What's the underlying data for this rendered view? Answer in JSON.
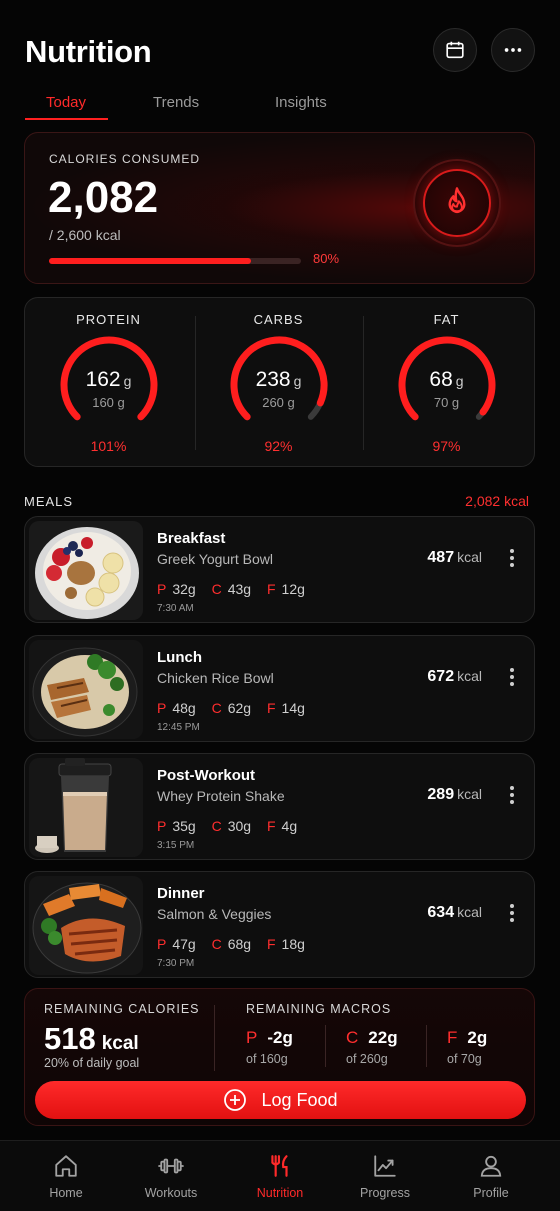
{
  "header": {
    "title": "Nutrition",
    "calendar_icon": "calendar-icon",
    "more_icon": "more-horizontal-icon"
  },
  "tabs": [
    {
      "label": "Today",
      "active": true
    },
    {
      "label": "Trends"
    },
    {
      "label": "Insights"
    }
  ],
  "calories": {
    "label": "CALORIES CONSUMED",
    "value": "2,082",
    "goal": "/ 2,600 kcal",
    "percent_label": "80%",
    "progress": 0.8,
    "icon": "flame-icon"
  },
  "macros": [
    {
      "name": "PROTEIN",
      "value": "162",
      "unit": "g",
      "goal": "160 g",
      "percent_label": "101%",
      "fraction": 1.0
    },
    {
      "name": "CARBS",
      "value": "238",
      "unit": "g",
      "goal": "260 g",
      "percent_label": "92%",
      "fraction": 0.92
    },
    {
      "name": "FAT",
      "value": "68",
      "unit": "g",
      "goal": "70 g",
      "percent_label": "97%",
      "fraction": 0.97
    }
  ],
  "meals": {
    "label": "MEALS",
    "total": "2,082 kcal",
    "items": [
      {
        "title": "Breakfast",
        "name": "Greek Yogurt Bowl",
        "kcal": "487",
        "unit": "kcal",
        "p": "32g",
        "c": "43g",
        "f": "12g",
        "time": "7:30 AM"
      },
      {
        "title": "Lunch",
        "name": "Chicken Rice Bowl",
        "kcal": "672",
        "unit": "kcal",
        "p": "48g",
        "c": "62g",
        "f": "14g",
        "time": "12:45 PM"
      },
      {
        "title": "Post-Workout",
        "name": "Whey Protein Shake",
        "kcal": "289",
        "unit": "kcal",
        "p": "35g",
        "c": "30g",
        "f": "4g",
        "time": "3:15 PM"
      },
      {
        "title": "Dinner",
        "name": "Salmon & Veggies",
        "kcal": "634",
        "unit": "kcal",
        "p": "47g",
        "c": "68g",
        "f": "18g",
        "time": "7:30 PM"
      }
    ],
    "macro_keys": {
      "p": "P",
      "c": "C",
      "f": "F"
    }
  },
  "remaining": {
    "cal_label": "REMAINING CALORIES",
    "cal_value": "518",
    "cal_unit": "kcal",
    "cal_note": "20% of daily goal",
    "macros_label": "REMAINING MACROS",
    "macros": [
      {
        "key": "P",
        "value": "-2g",
        "of": "of 160g"
      },
      {
        "key": "C",
        "value": "22g",
        "of": "of 260g"
      },
      {
        "key": "F",
        "value": "2g",
        "of": "of 70g"
      }
    ]
  },
  "log_button": {
    "label": "Log Food",
    "icon": "plus-circle-icon"
  },
  "nav": [
    {
      "label": "Home",
      "icon": "home-icon"
    },
    {
      "label": "Workouts",
      "icon": "dumbbell-icon"
    },
    {
      "label": "Nutrition",
      "icon": "fork-knife-icon",
      "active": true
    },
    {
      "label": "Progress",
      "icon": "chart-line-icon"
    },
    {
      "label": "Profile",
      "icon": "user-icon"
    }
  ],
  "colors": {
    "accent": "#ff2a2a",
    "background": "#050505",
    "card": "#0e0e0e"
  }
}
